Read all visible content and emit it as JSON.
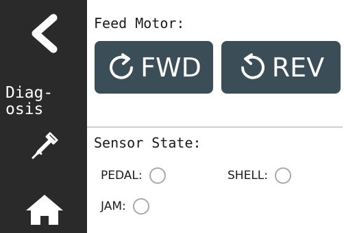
{
  "sidebar": {
    "back_icon": "chevron-left-icon",
    "title": "Diag-\nosis",
    "probe_icon": "probe-pipette-icon",
    "home_icon": "home-icon"
  },
  "feed_motor": {
    "label": "Feed Motor:",
    "fwd_label": "FWD",
    "fwd_icon": "rotate-clockwise-icon",
    "rev_label": "REV",
    "rev_icon": "rotate-counterclockwise-icon"
  },
  "sensor_state": {
    "label": "Sensor State:",
    "pedal_label": "PEDAL:",
    "shell_label": "SHELL:",
    "jam_label": "JAM:"
  },
  "colors": {
    "sidebar_bg": "#2a2a2a",
    "button_bg": "#3b4e58",
    "indicator_border": "#a8a8a8"
  }
}
